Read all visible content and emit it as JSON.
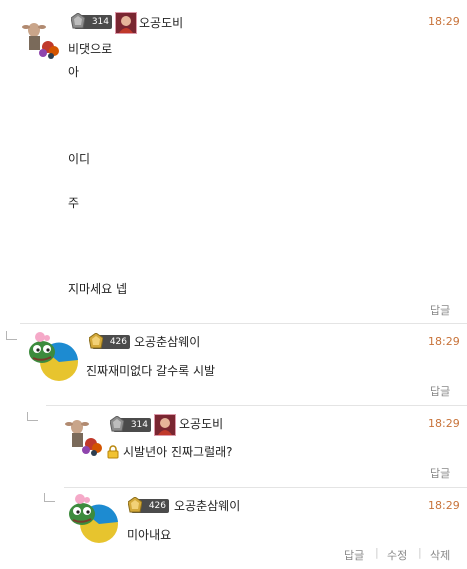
{
  "comments": [
    {
      "user_name": "오공도비",
      "level": "314",
      "time": "18:29",
      "lines": [
        "비댓으로",
        "아",
        "이디",
        "주",
        "지마세요 넵"
      ],
      "reply_label": "답글"
    },
    {
      "user_name": "오공춘삼웨이",
      "level": "426",
      "time": "18:29",
      "text": "진짜재미없다 갈수록 시발",
      "reply_label": "답글"
    },
    {
      "user_name": "오공도비",
      "level": "314",
      "time": "18:29",
      "text": "시발년아 진짜그럴래?",
      "reply_label": "답글"
    },
    {
      "user_name": "오공춘삼웨이",
      "level": "426",
      "time": "18:29",
      "text": "미아내요",
      "actions": [
        "답글",
        "수정",
        "삭제"
      ]
    }
  ],
  "colors": {
    "time": "#c8733a",
    "divider": "#e4e4e4",
    "badge": "#4b4b4b"
  }
}
